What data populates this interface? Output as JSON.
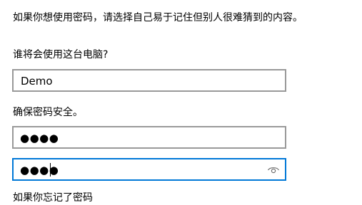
{
  "intro_text": "如果你想使用密码，请选择自己易于记住但别人很难猜到的内容。",
  "who_label": "谁将会使用这台电脑?",
  "username": {
    "value": "Demo"
  },
  "secure_label": "确保密码安全。",
  "password": {
    "masked_value": "●●●●"
  },
  "confirm_password": {
    "masked_value": "●●●●"
  },
  "forgot_label": "如果你忘记了密码",
  "colors": {
    "accent": "#0078d7",
    "field_border": "#999999",
    "text": "#000000"
  },
  "icons": {
    "reveal": "eye-icon"
  }
}
